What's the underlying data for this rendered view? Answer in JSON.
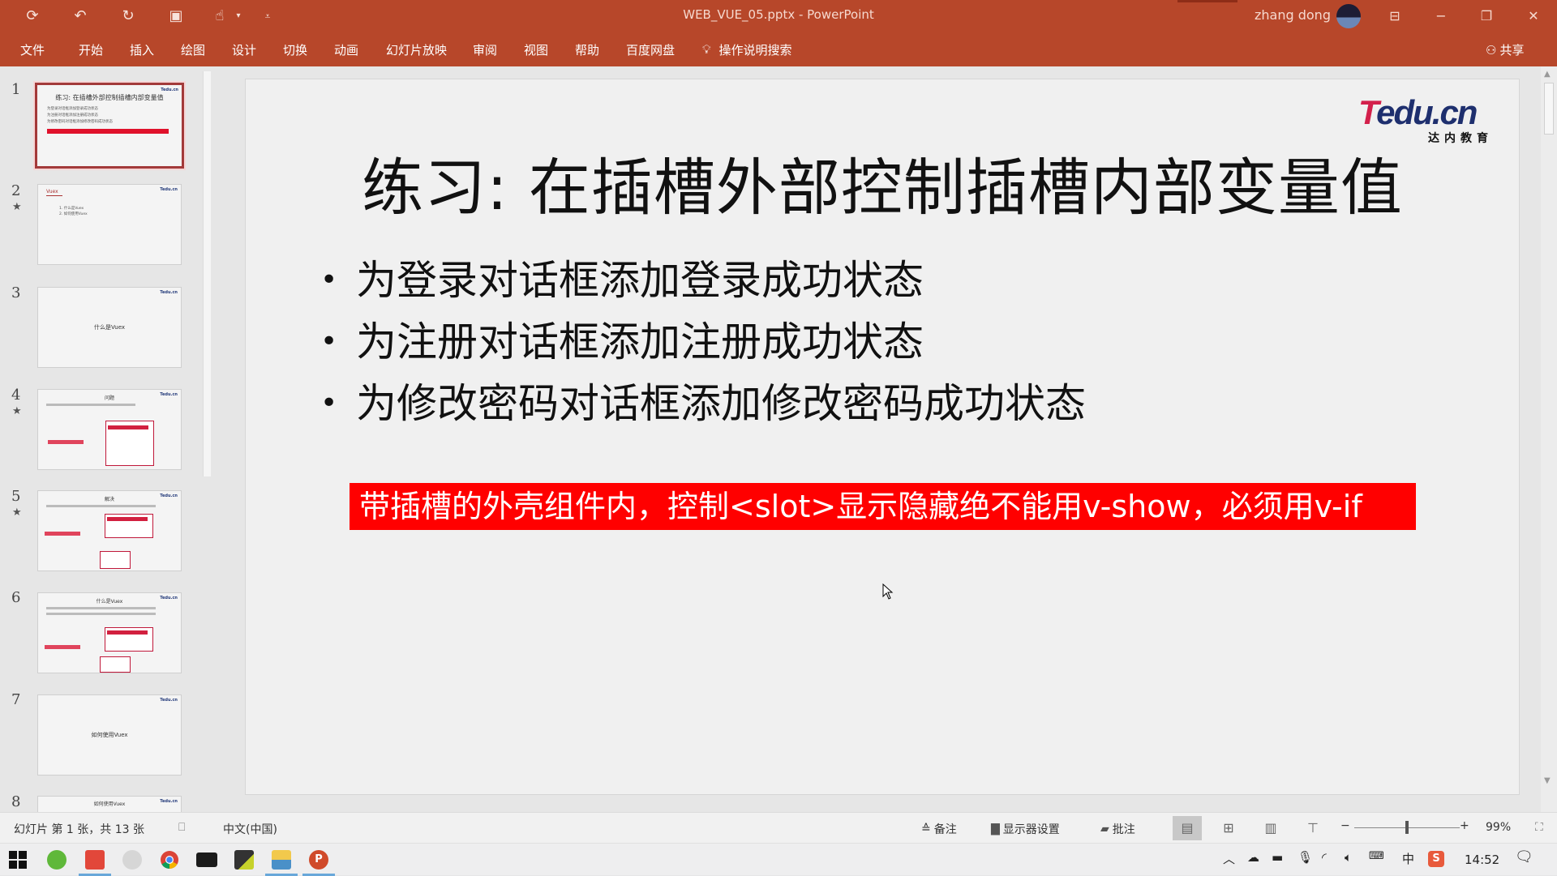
{
  "window": {
    "title": "WEB_VUE_05.pptx  -  PowerPoint",
    "user_name": "zhang dong",
    "controls": [
      "ribbon-display-options",
      "minimize",
      "restore",
      "close"
    ]
  },
  "quick_access": {
    "items": [
      {
        "name": "autosave-icon",
        "glyph": "⟳"
      },
      {
        "name": "undo-icon",
        "glyph": "↶"
      },
      {
        "name": "redo-icon",
        "glyph": "↻"
      },
      {
        "name": "start-slideshow-icon",
        "glyph": "▣"
      },
      {
        "name": "touch-mode-icon",
        "glyph": "☝"
      },
      {
        "name": "customize-qat-icon",
        "glyph": "⩡"
      }
    ],
    "touch_dropdown": "▾"
  },
  "ribbon": {
    "tabs": [
      "文件",
      "开始",
      "插入",
      "绘图",
      "设计",
      "切换",
      "动画",
      "幻灯片放映",
      "审阅",
      "视图",
      "帮助",
      "百度网盘"
    ],
    "tell_me": "操作说明搜索",
    "share": "共享"
  },
  "thumbnails": [
    {
      "number": "1",
      "starred": false,
      "selected": true,
      "kind": "bullets-red",
      "title": "练习: 在插槽外部控制插槽内部变量值",
      "lines": [
        "为登录对话框添加登录成功状态",
        "为注册对话框添加注册成功状态",
        "为修改密码对话框添加修改密码成功状态"
      ]
    },
    {
      "number": "2",
      "starred": true,
      "selected": false,
      "kind": "list",
      "title": "Vuex",
      "lines": [
        "1. 什么是Vuex",
        "2. 如何使用Vuex"
      ]
    },
    {
      "number": "3",
      "starred": false,
      "selected": false,
      "kind": "center",
      "title": "什么是Vuex",
      "lines": []
    },
    {
      "number": "4",
      "starred": true,
      "selected": false,
      "kind": "diagram",
      "title": "问题",
      "lines": []
    },
    {
      "number": "5",
      "starred": true,
      "selected": false,
      "kind": "diagram",
      "title": "解决",
      "lines": []
    },
    {
      "number": "6",
      "starred": false,
      "selected": false,
      "kind": "diagram",
      "title": "什么是Vuex",
      "lines": []
    },
    {
      "number": "7",
      "starred": false,
      "selected": false,
      "kind": "center",
      "title": "如何使用Vuex",
      "lines": []
    },
    {
      "number": "8",
      "starred": false,
      "selected": false,
      "kind": "partial",
      "title": "如何使用Vuex",
      "lines": []
    }
  ],
  "slide": {
    "logo_brand_t": "T",
    "logo_brand_rest": "edu.cn",
    "logo_sub": "达内教育",
    "title": "练习: 在插槽外部控制插槽内部变量值",
    "bullets": [
      "为登录对话框添加登录成功状态",
      "为注册对话框添加注册成功状态",
      "为修改密码对话框添加修改密码成功状态"
    ],
    "highlight": "带插槽的外壳组件内，控制<slot>显示隐藏绝不能用v-show，必须用v-if",
    "highlight_color": "#ff0000"
  },
  "statusbar": {
    "slide_info": "幻灯片 第 1 张，共 13 张",
    "language": "中文(中国)",
    "notes": "备注",
    "display_settings": "显示器设置",
    "comments": "批注",
    "zoom_out": "−",
    "zoom_in": "+",
    "zoom_level": "99%",
    "zoom_fraction": 0.5
  },
  "taskbar": {
    "apps": [
      {
        "name": "start-button",
        "label": "Start",
        "active": false,
        "color": "#111111"
      },
      {
        "name": "app-green",
        "label": "Green app",
        "active": false,
        "color": "#5fb83a"
      },
      {
        "name": "app-camtasia",
        "label": "Recorder",
        "active": true,
        "color": "#e2473a"
      },
      {
        "name": "app-brush",
        "label": "Brush tool",
        "active": false,
        "color": "#c9c9c9"
      },
      {
        "name": "app-chrome",
        "label": "Chrome",
        "active": false,
        "color": "#e4b52b"
      },
      {
        "name": "app-terminal",
        "label": "Terminal",
        "active": false,
        "color": "#1b1b1b"
      },
      {
        "name": "app-sublime",
        "label": "Editor",
        "active": false,
        "color": "#333333"
      },
      {
        "name": "app-explorer",
        "label": "File Explorer",
        "active": true,
        "color": "#f2c94c"
      },
      {
        "name": "app-powerpoint",
        "label": "PowerPoint",
        "active": true,
        "color": "#d04a2a"
      }
    ],
    "tray": {
      "ime": "中",
      "clock": "14:52"
    }
  }
}
